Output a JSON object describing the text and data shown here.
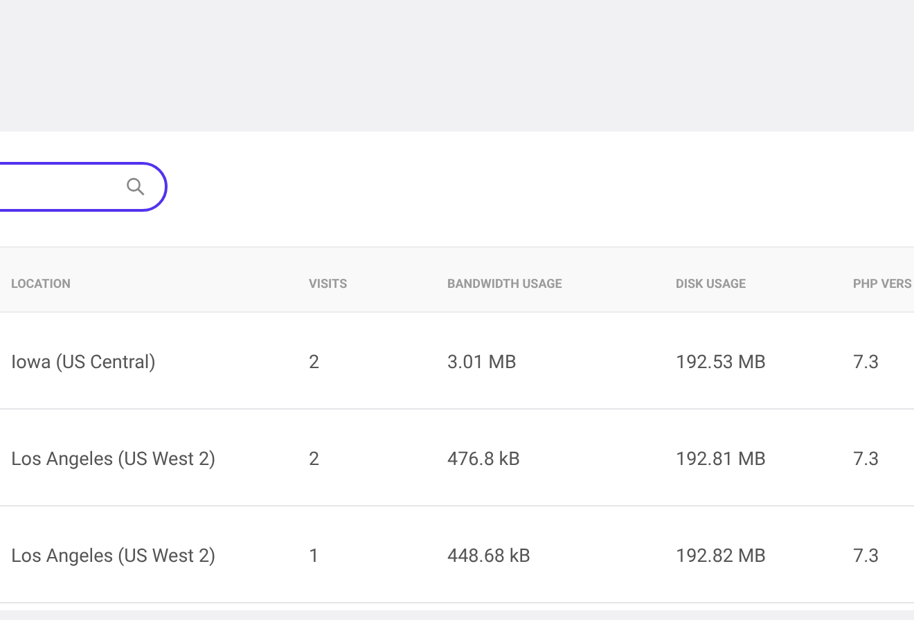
{
  "table": {
    "columns": [
      "LOCATION",
      "VISITS",
      "BANDWIDTH USAGE",
      "DISK USAGE",
      "PHP VERS"
    ],
    "rows": [
      [
        "Iowa (US Central)",
        "2",
        "3.01 MB",
        "192.53 MB",
        "7.3"
      ],
      [
        "Los Angeles (US West 2)",
        "2",
        "476.8 kB",
        "192.81 MB",
        "7.3"
      ],
      [
        "Los Angeles (US West 2)",
        "1",
        "448.68 kB",
        "192.82 MB",
        "7.3"
      ]
    ]
  }
}
